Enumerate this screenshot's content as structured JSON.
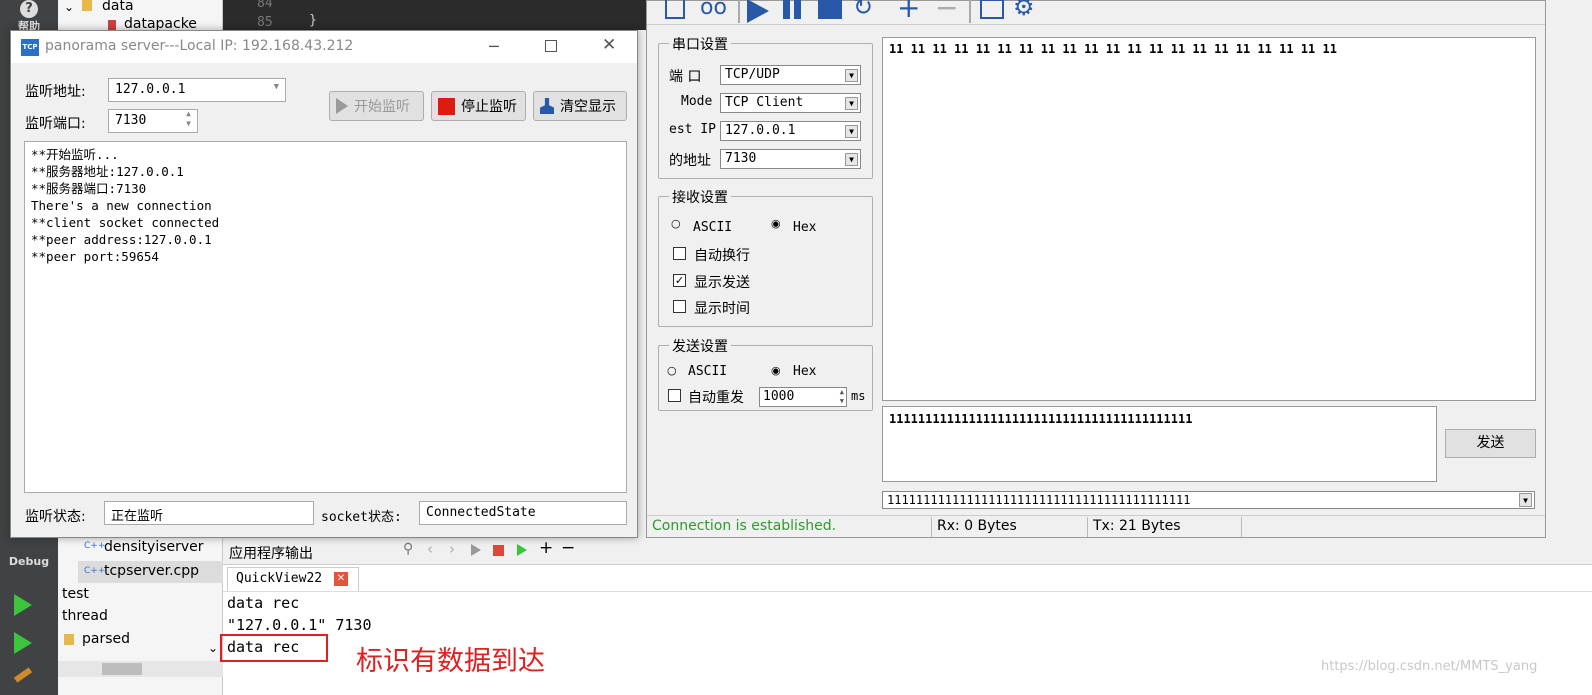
{
  "qt": {
    "help_label": "帮助",
    "tree_folder": "data",
    "tree_file_partial": "datapacke",
    "editor_line1": "84",
    "editor_line2": "85",
    "editor_brace": "}",
    "debug_label": "Debug",
    "tree_items": [
      "densityiserver",
      "tcpserver.cpp",
      "test",
      "thread",
      "parsed"
    ],
    "output_panel_title": "应用程序输出",
    "output_tab": "QuickView22",
    "output_lines": [
      "data rec",
      "\"127.0.0.1\" 7130",
      "data rec"
    ],
    "annotation": "标识有数据到达",
    "watermark": "https://blog.csdn.net/MMTS_yang"
  },
  "pano": {
    "icon_text": "TCP",
    "title": "panorama server---Local IP: 192.168.43.212",
    "addr_label": "监听地址:",
    "addr_value": "127.0.0.1",
    "port_label": "监听端口:",
    "port_value": "7130",
    "start_button": "开始监听",
    "stop_button": "停止监听",
    "clear_button": "清空显示",
    "log_lines": [
      "**开始监听...",
      "**服务器地址:127.0.0.1",
      "**服务器端口:7130",
      "There's a new connection",
      "**client socket connected",
      "**peer address:127.0.0.1",
      "**peer port:59654"
    ],
    "listen_status_label": "监听状态:",
    "listen_status_value": "正在监听",
    "socket_status_label": "socket状态:",
    "socket_status_value": "ConnectedState"
  },
  "serial": {
    "port_group": "串口设置",
    "port_label": "端 口",
    "port_value": "TCP/UDP",
    "mode_label": "Mode",
    "mode_value": "TCP Client",
    "ip_label": "est IP",
    "ip_value": "127.0.0.1",
    "addr_label": "的地址",
    "addr_value": "7130",
    "recv_group": "接收设置",
    "recv_ascii": "ASCII",
    "recv_hex": "Hex",
    "auto_newline": "自动换行",
    "show_send": "显示发送",
    "show_time": "显示时间",
    "send_group": "发送设置",
    "send_ascii": "ASCII",
    "send_hex": "Hex",
    "auto_resend": "自动重发",
    "interval_value": "1000",
    "interval_unit": "ms",
    "receive_text": "11 11 11 11 11 11 11 11 11 11 11 11 11 11 11 11 11 11 11 11 11",
    "send_text": "111111111111111111111111111111111111111111",
    "send_button": "发送",
    "history_value": "111111111111111111111111111111111111111111",
    "status_connection": "Connection is established.",
    "status_rx": "Rx: 0 Bytes",
    "status_tx": "Tx: 21 Bytes",
    "status_color": "#2e9a2e"
  }
}
